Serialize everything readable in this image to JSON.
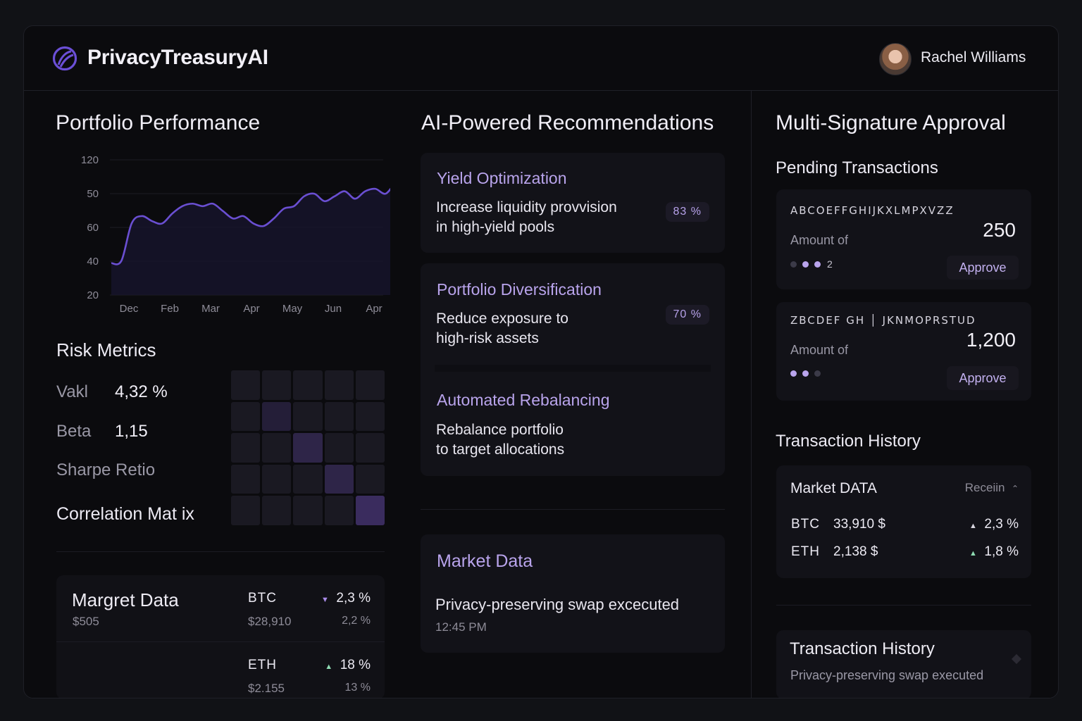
{
  "app": {
    "name": "PrivacyTreasuryAI",
    "user_name": "Rachel Williams"
  },
  "portfolio": {
    "title": "Portfolio Performance",
    "chart_data": {
      "type": "area",
      "y_ticks": [
        "120",
        "50",
        "60",
        "40",
        "20"
      ],
      "x_ticks": [
        "Dec",
        "Feb",
        "Mar",
        "Apr",
        "May",
        "Jun",
        "Apr"
      ],
      "series": [
        {
          "values": [
            1.0,
            1.1,
            2.6,
            2.9,
            2.7,
            2.6,
            3.0,
            3.3,
            3.4,
            3.3,
            3.4,
            3.1,
            2.8,
            2.9,
            2.6,
            2.5,
            2.8,
            3.2,
            3.3,
            3.7,
            3.8,
            3.5,
            3.7,
            3.9,
            3.6,
            3.9,
            4.0,
            3.8,
            4.2,
            4.1
          ]
        }
      ],
      "line_color": "#6a4fd2"
    }
  },
  "risk": {
    "title": "Risk Metrics",
    "metrics": [
      {
        "label": "Vakl",
        "value": "4,32 %"
      },
      {
        "label": "Beta",
        "value": "1,15"
      },
      {
        "label": "Sharpe Retio",
        "value": ""
      }
    ],
    "matrix_title": "Correlation Mat ix",
    "matrix_levels": [
      [
        1,
        1,
        1,
        1,
        1
      ],
      [
        1,
        2,
        1,
        1,
        1
      ],
      [
        1,
        1,
        3,
        1,
        1
      ],
      [
        1,
        1,
        1,
        3,
        1
      ],
      [
        1,
        1,
        1,
        1,
        4
      ]
    ]
  },
  "left_market": {
    "title": "Margret Data",
    "subvalue": "$505",
    "rows": [
      {
        "symbol": "BTC",
        "price": "$28,910",
        "change": "2,3 %",
        "direction": "down",
        "change2": "2,2 %"
      },
      {
        "symbol": "ETH",
        "price": "$2.155",
        "change": "18 %",
        "direction": "up",
        "change2": "13 %"
      }
    ]
  },
  "recommendations": {
    "title": "AI-Powered Recommendations",
    "items": [
      {
        "title": "Yield Optimization",
        "line1": "Increase liquidity provvision",
        "line2": "in high-yield pools",
        "confidence": "83 %"
      },
      {
        "title": "Portfolio Diversification",
        "line1": "Reduce exposure to",
        "line2": "high-risk assets",
        "confidence": "70 %"
      },
      {
        "title": "Automated Rebalancing",
        "line1": "Rebalance portfolio",
        "line2": "to target allocations",
        "confidence": ""
      }
    ]
  },
  "mid_market": {
    "title": "Market Data",
    "event": "Privacy-preserving swap excecuted",
    "time": "12:45 PM"
  },
  "multisig": {
    "title": "Multi-Signature Approval",
    "pending_title": "Pending Transactions",
    "transactions": [
      {
        "id": "ABCOEFFGHIJKXLMPXVZZ",
        "amount_label": "Amount of",
        "amount": "250",
        "signatures_count": "2",
        "signatures": [
          0,
          1,
          1
        ],
        "approve_label": "Approve"
      },
      {
        "id": "ZBCDEF GH │ JKNMOPRSTUD",
        "amount_label": "Amount of",
        "amount": "1,200",
        "signatures_count": "",
        "signatures": [
          1,
          1,
          0
        ],
        "approve_label": "Approve"
      }
    ],
    "history_title": "Transaction History",
    "market": {
      "title": "Market DATA",
      "filter": "Receiin",
      "rows": [
        {
          "symbol": "BTC",
          "price": "33,910 $",
          "change": "2,3 %"
        },
        {
          "symbol": "ETH",
          "price": "2,138 $",
          "change": "1,8 %"
        }
      ]
    },
    "history_card": {
      "title": "Transaction History",
      "text": "Privacy-preserving swap executed"
    }
  },
  "colors": {
    "accent": "#6a4fd2",
    "accent_text": "#b9a4ec",
    "up": "#8fdcb3",
    "down": "#a98be8"
  }
}
